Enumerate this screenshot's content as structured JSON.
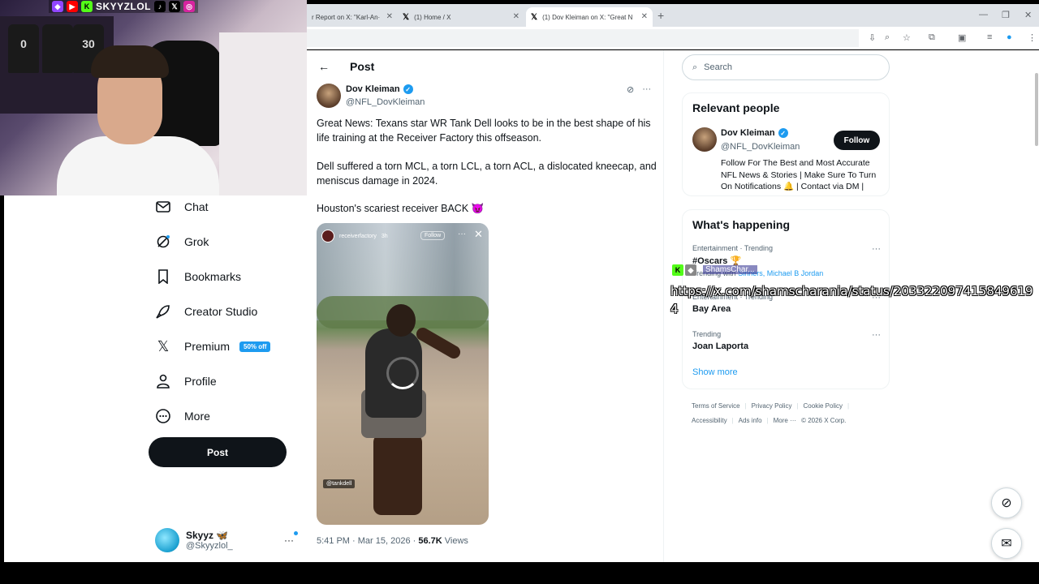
{
  "browser": {
    "tabs": [
      {
        "title": "r Report on X: \"Karl-An·",
        "active": false
      },
      {
        "title": "(1) Home / X",
        "active": false
      },
      {
        "title": "(1) Dov Kleiman on X: \"Great N",
        "active": true
      }
    ],
    "new_tab": "+"
  },
  "stream": {
    "channel_name": "SKYYZLOL",
    "social_icons": [
      "twitch-icon",
      "youtube-icon",
      "kick-icon",
      "tiktok-icon",
      "x-icon",
      "instagram-icon"
    ],
    "chat_user": "ShamsChar...",
    "chat_url": "https://x.com/shamscharania/status/2033220974158496194"
  },
  "nav": {
    "items": [
      {
        "label": "Chat",
        "icon": "mail-icon"
      },
      {
        "label": "Grok",
        "icon": "grok-icon"
      },
      {
        "label": "Bookmarks",
        "icon": "bookmark-icon"
      },
      {
        "label": "Creator Studio",
        "icon": "rocket-icon"
      },
      {
        "label": "Premium",
        "icon": "x-logo-icon",
        "badge": "50% off"
      },
      {
        "label": "Profile",
        "icon": "person-icon"
      },
      {
        "label": "More",
        "icon": "more-circle-icon"
      }
    ],
    "post_button": "Post",
    "account": {
      "name": "Skyyz 🦋",
      "handle": "@Skyyzlol_",
      "more": "···"
    }
  },
  "post": {
    "header_title": "Post",
    "author_name": "Dov Kleiman",
    "author_handle": "@NFL_DovKleiman",
    "paragraphs": [
      "Great News: Texans star WR Tank Dell looks to be in the best shape of his life training at the Receiver Factory this offseason.",
      "Dell suffered a torn MCL, a torn LCL, a torn ACL, a dislocated kneecap, and meniscus damage in 2024.",
      "Houston's scariest receiver BACK 😈"
    ],
    "media": {
      "account": "receiverfactory",
      "age": "3h",
      "follow_label": "Follow",
      "tag": "@tankdell"
    },
    "timestamp": "5:41 PM · Mar 15, 2026 ·",
    "views_count": "56.7K",
    "views_label": "Views"
  },
  "sidebar": {
    "search_placeholder": "Search",
    "relevant": {
      "title": "Relevant people",
      "name": "Dov Kleiman",
      "handle": "@NFL_DovKleiman",
      "follow_label": "Follow",
      "bio": "Follow For The Best and Most Accurate NFL News & Stories | Make Sure To Turn On Notifications 🔔 | Contact via DM |"
    },
    "happening": {
      "title": "What's happening",
      "trends": [
        {
          "meta": "Entertainment · Trending",
          "name": "#Oscars 🏆",
          "sub_prefix": "Trending with",
          "sub_links": "Sinners, Michael B Jordan"
        },
        {
          "meta": "Entertainment · Trending",
          "name": "Bay Area",
          "sub_prefix": "",
          "sub_links": ""
        },
        {
          "meta": "Trending",
          "name": "Joan Laporta",
          "sub_prefix": "",
          "sub_links": ""
        }
      ],
      "show_more": "Show more"
    },
    "footer": {
      "row1": [
        "Terms of Service",
        "Privacy Policy",
        "Cookie Policy"
      ],
      "row2": [
        "Accessibility",
        "Ads info",
        "More ···",
        "© 2026 X Corp."
      ]
    }
  }
}
